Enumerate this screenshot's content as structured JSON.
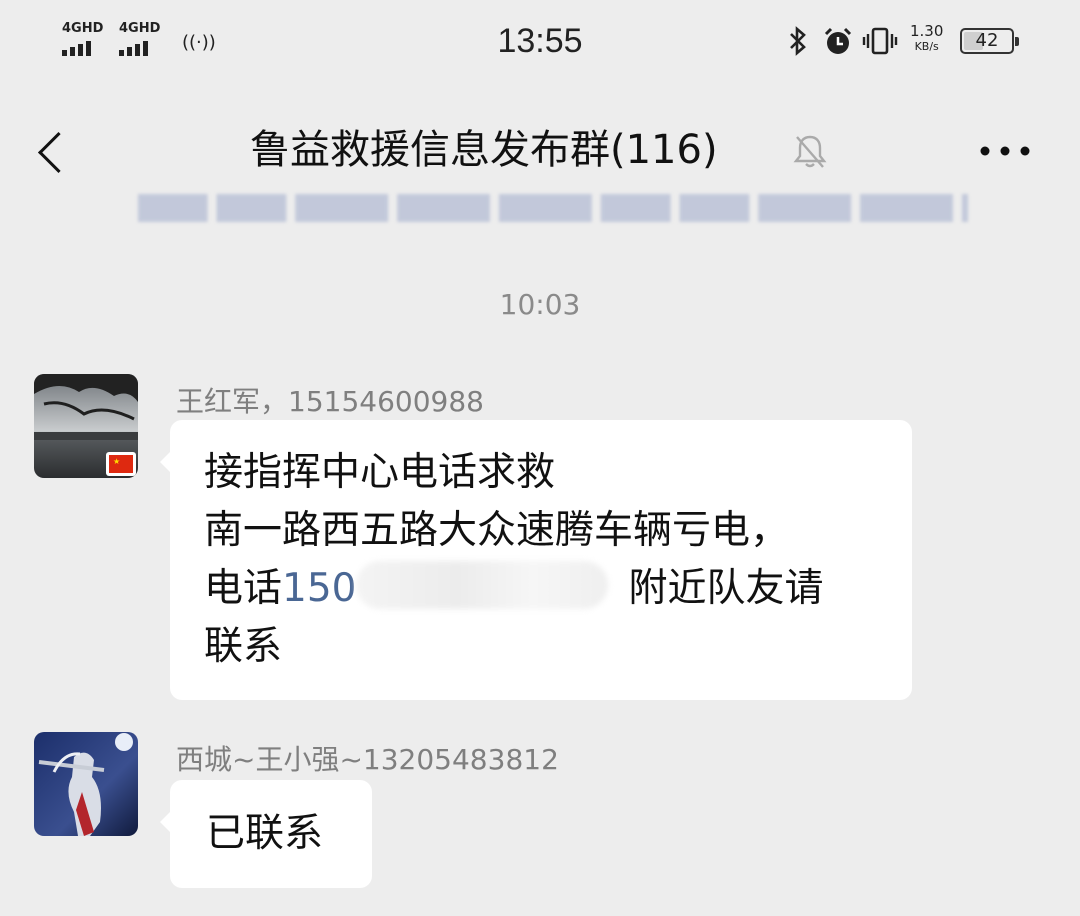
{
  "status_bar": {
    "network_1": "4GHD",
    "network_2": "4GHD",
    "time": "13:55",
    "speed_value": "1.30",
    "speed_unit": "KB/s",
    "battery": "42",
    "battery_level": 0.42
  },
  "nav": {
    "title": "鲁益救援信息发布群(116)",
    "back_icon": "chevron-left-icon",
    "mute_icon": "bell-off-icon",
    "more_icon": "more-dots-icon"
  },
  "chat": {
    "time_separator": "10:03",
    "messages": [
      {
        "sender": "王红军，15154600988",
        "line1": "接指挥中心电话求救",
        "line2": "南一路西五路大众速腾车辆亏电，",
        "line3_prefix": "电话",
        "line3_phone": "150",
        "line3_suffix": "附近队友请",
        "line4": "联系"
      },
      {
        "sender": "西城~王小强~13205483812",
        "text": "已联系"
      }
    ]
  }
}
